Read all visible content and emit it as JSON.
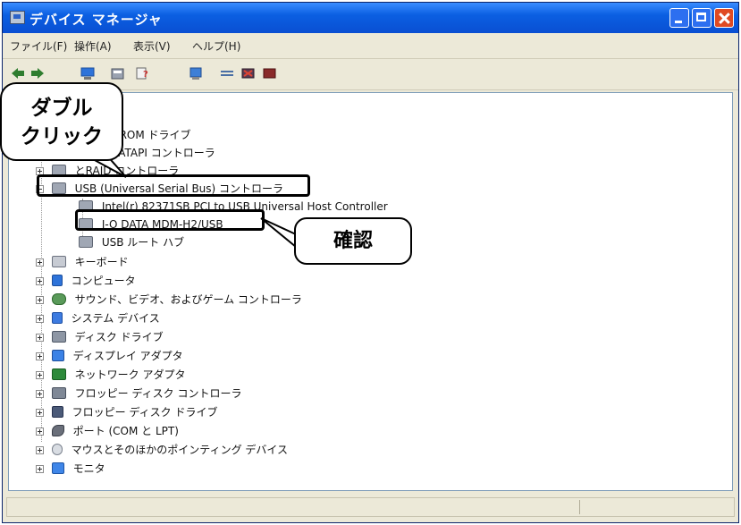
{
  "window": {
    "title": "デバイス マネージャ"
  },
  "menu": {
    "items": [
      "ファイル(F)",
      "操作(A)",
      "表示(V)",
      "ヘルプ(H)"
    ]
  },
  "toolbar": {
    "buttons": [
      "back-icon",
      "forward-icon",
      "computer-icon",
      "print-icon",
      "help-icon",
      "scan-icon",
      "update-icon",
      "disable-icon",
      "uninstall-icon"
    ]
  },
  "tree": {
    "nodes": [
      {
        "label": "D-ROM ドライブ",
        "icon": "cdrom-icon"
      },
      {
        "label": "A/ATAPI コントローラ",
        "icon": "ide-icon"
      },
      {
        "label": "とRAID コントローラ",
        "icon": "scsi-icon"
      },
      {
        "label": "USB (Universal Serial Bus) コントローラ",
        "icon": "usb-icon"
      },
      {
        "label": "Intel(r) 82371SB PCI to USB Universal Host Controller",
        "icon": "usb-icon"
      },
      {
        "label": "I-O DATA MDM-H2/USB",
        "icon": "usb-icon"
      },
      {
        "label": "USB ルート ハブ",
        "icon": "usb-icon"
      },
      {
        "label": "キーボード",
        "icon": "keyboard-icon"
      },
      {
        "label": "コンピュータ",
        "icon": "computer-icon"
      },
      {
        "label": "サウンド、ビデオ、およびゲーム コントローラ",
        "icon": "sound-icon"
      },
      {
        "label": "システム デバイス",
        "icon": "system-icon"
      },
      {
        "label": "ディスク ドライブ",
        "icon": "disk-icon"
      },
      {
        "label": "ディスプレイ アダプタ",
        "icon": "display-icon"
      },
      {
        "label": "ネットワーク アダプタ",
        "icon": "network-icon"
      },
      {
        "label": "フロッピー ディスク コントローラ",
        "icon": "floppy-controller-icon"
      },
      {
        "label": "フロッピー ディスク ドライブ",
        "icon": "floppy-drive-icon"
      },
      {
        "label": "ポート (COM と LPT)",
        "icon": "port-icon"
      },
      {
        "label": "マウスとそのほかのポインティング デバイス",
        "icon": "mouse-icon"
      },
      {
        "label": "モニタ",
        "icon": "monitor-icon"
      }
    ]
  },
  "callouts": {
    "double_click": [
      "ダブル",
      "クリック"
    ],
    "confirm": "確認"
  },
  "colors": {
    "titlebar": "#0b5fe2",
    "window_bg": "#ece9d8",
    "close_button": "#e04a22"
  }
}
